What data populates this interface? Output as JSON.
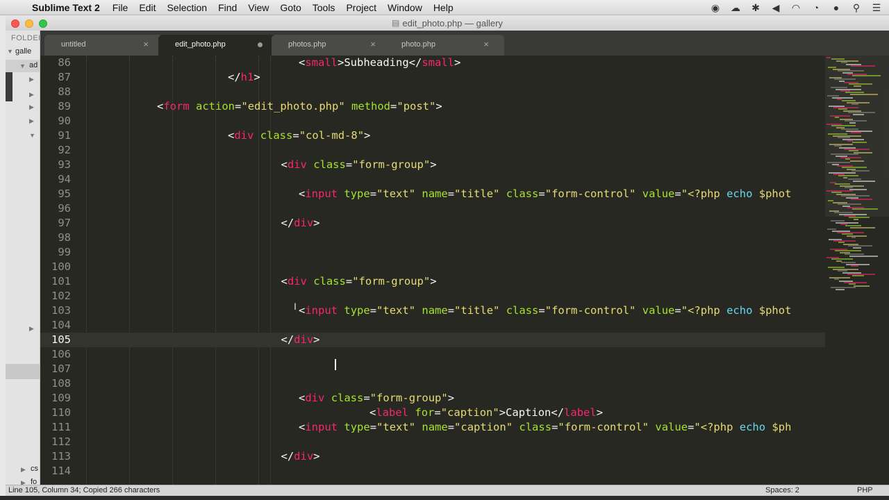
{
  "menubar": {
    "app_name": "Sublime Text 2",
    "items": [
      "File",
      "Edit",
      "Selection",
      "Find",
      "View",
      "Goto",
      "Tools",
      "Project",
      "Window",
      "Help"
    ],
    "status_icons": [
      "record-icon",
      "creative-cloud-icon",
      "bluetooth-icon",
      "volume-icon",
      "wifi-icon",
      "clock-icon",
      "user-icon",
      "spotlight-search-icon",
      "notification-list-icon"
    ]
  },
  "window": {
    "title": "edit_photo.php — gallery"
  },
  "sidebar": {
    "header": "FOLDER",
    "items": [
      "galle",
      "ad",
      "cs",
      "fo"
    ]
  },
  "tabs": [
    {
      "label": "untitled",
      "close": "×",
      "dirty": false,
      "active": false
    },
    {
      "label": "edit_photo.php",
      "close": "",
      "dirty": true,
      "active": true
    },
    {
      "label": "photos.php",
      "close": "×",
      "dirty": false,
      "active": false
    },
    {
      "label": "photo.php",
      "close": "×",
      "dirty": false,
      "active": false
    }
  ],
  "editor": {
    "current_line": 105,
    "lines": [
      {
        "num": "86",
        "indent": 12,
        "tokens": [
          [
            "t-p",
            "<"
          ],
          [
            "t-tag",
            "small"
          ],
          [
            "t-p",
            ">Subheading</"
          ],
          [
            "t-tag",
            "small"
          ],
          [
            "t-p",
            ">"
          ]
        ]
      },
      {
        "num": "87",
        "indent": 8,
        "tokens": [
          [
            "t-p",
            "</"
          ],
          [
            "t-tag",
            "h1"
          ],
          [
            "t-p",
            ">"
          ]
        ]
      },
      {
        "num": "88",
        "indent": 0,
        "tokens": []
      },
      {
        "num": "89",
        "indent": 4,
        "tokens": [
          [
            "t-p",
            "<"
          ],
          [
            "t-tag",
            "form"
          ],
          [
            "t-p",
            " "
          ],
          [
            "t-attr",
            "action"
          ],
          [
            "t-p",
            "="
          ],
          [
            "t-str",
            "\"edit_photo.php\""
          ],
          [
            "t-p",
            " "
          ],
          [
            "t-attr",
            "method"
          ],
          [
            "t-p",
            "="
          ],
          [
            "t-str",
            "\"post\""
          ],
          [
            "t-p",
            ">"
          ]
        ]
      },
      {
        "num": "90",
        "indent": 0,
        "tokens": []
      },
      {
        "num": "91",
        "indent": 8,
        "tokens": [
          [
            "t-p",
            "<"
          ],
          [
            "t-tag",
            "div"
          ],
          [
            "t-p",
            " "
          ],
          [
            "t-attr",
            "class"
          ],
          [
            "t-p",
            "="
          ],
          [
            "t-str",
            "\"col-md-8\""
          ],
          [
            "t-p",
            ">"
          ]
        ]
      },
      {
        "num": "92",
        "indent": 0,
        "tokens": []
      },
      {
        "num": "93",
        "indent": 11,
        "tokens": [
          [
            "t-p",
            "<"
          ],
          [
            "t-tag",
            "div"
          ],
          [
            "t-p",
            " "
          ],
          [
            "t-attr",
            "class"
          ],
          [
            "t-p",
            "="
          ],
          [
            "t-str",
            "\"form-group\""
          ],
          [
            "t-p",
            ">"
          ]
        ]
      },
      {
        "num": "94",
        "indent": 0,
        "tokens": []
      },
      {
        "num": "95",
        "indent": 12,
        "tokens": [
          [
            "t-p",
            "<"
          ],
          [
            "t-tag",
            "input"
          ],
          [
            "t-p",
            " "
          ],
          [
            "t-attr",
            "type"
          ],
          [
            "t-p",
            "="
          ],
          [
            "t-str",
            "\"text\""
          ],
          [
            "t-p",
            " "
          ],
          [
            "t-attr",
            "name"
          ],
          [
            "t-p",
            "="
          ],
          [
            "t-str",
            "\"title\""
          ],
          [
            "t-p",
            " "
          ],
          [
            "t-attr",
            "class"
          ],
          [
            "t-p",
            "="
          ],
          [
            "t-str",
            "\"form-control\""
          ],
          [
            "t-p",
            " "
          ],
          [
            "t-attr",
            "value"
          ],
          [
            "t-p",
            "="
          ],
          [
            "t-str",
            "\"<?php "
          ],
          [
            "t-kw",
            "echo"
          ],
          [
            "t-p",
            " "
          ],
          [
            "t-str",
            "$phot"
          ]
        ]
      },
      {
        "num": "96",
        "indent": 0,
        "tokens": []
      },
      {
        "num": "97",
        "indent": 11,
        "tokens": [
          [
            "t-p",
            "</"
          ],
          [
            "t-tag",
            "div"
          ],
          [
            "t-p",
            ">"
          ]
        ]
      },
      {
        "num": "98",
        "indent": 0,
        "tokens": []
      },
      {
        "num": "99",
        "indent": 0,
        "tokens": []
      },
      {
        "num": "100",
        "indent": 0,
        "tokens": []
      },
      {
        "num": "101",
        "indent": 11,
        "tokens": [
          [
            "t-p",
            "<"
          ],
          [
            "t-tag",
            "div"
          ],
          [
            "t-p",
            " "
          ],
          [
            "t-attr",
            "class"
          ],
          [
            "t-p",
            "="
          ],
          [
            "t-str",
            "\"form-group\""
          ],
          [
            "t-p",
            ">"
          ]
        ]
      },
      {
        "num": "102",
        "indent": 0,
        "tokens": []
      },
      {
        "num": "103",
        "indent": 12,
        "tokens": [
          [
            "t-p",
            "<"
          ],
          [
            "t-tag",
            "input"
          ],
          [
            "t-p",
            " "
          ],
          [
            "t-attr",
            "type"
          ],
          [
            "t-p",
            "="
          ],
          [
            "t-str",
            "\"text\""
          ],
          [
            "t-p",
            " "
          ],
          [
            "t-attr",
            "name"
          ],
          [
            "t-p",
            "="
          ],
          [
            "t-str",
            "\"title\""
          ],
          [
            "t-p",
            " "
          ],
          [
            "t-attr",
            "class"
          ],
          [
            "t-p",
            "="
          ],
          [
            "t-str",
            "\"form-control\""
          ],
          [
            "t-p",
            " "
          ],
          [
            "t-attr",
            "value"
          ],
          [
            "t-p",
            "="
          ],
          [
            "t-str",
            "\"<?php "
          ],
          [
            "t-kw",
            "echo"
          ],
          [
            "t-p",
            " "
          ],
          [
            "t-str",
            "$phot"
          ]
        ]
      },
      {
        "num": "104",
        "indent": 0,
        "tokens": []
      },
      {
        "num": "105",
        "indent": 11,
        "tokens": [
          [
            "t-p",
            "</"
          ],
          [
            "t-tag",
            "div"
          ],
          [
            "t-p",
            ">"
          ]
        ]
      },
      {
        "num": "106",
        "indent": 0,
        "tokens": []
      },
      {
        "num": "107",
        "indent": 0,
        "tokens": []
      },
      {
        "num": "108",
        "indent": 0,
        "tokens": []
      },
      {
        "num": "109",
        "indent": 12,
        "tokens": [
          [
            "t-p",
            "<"
          ],
          [
            "t-tag",
            "div"
          ],
          [
            "t-p",
            " "
          ],
          [
            "t-attr",
            "class"
          ],
          [
            "t-p",
            "="
          ],
          [
            "t-str",
            "\"form-group\""
          ],
          [
            "t-p",
            ">"
          ]
        ]
      },
      {
        "num": "110",
        "indent": 16,
        "tokens": [
          [
            "t-p",
            "<"
          ],
          [
            "t-tag",
            "label"
          ],
          [
            "t-p",
            " "
          ],
          [
            "t-attr",
            "for"
          ],
          [
            "t-p",
            "="
          ],
          [
            "t-str",
            "\"caption\""
          ],
          [
            "t-p",
            ">Caption</"
          ],
          [
            "t-tag",
            "label"
          ],
          [
            "t-p",
            ">"
          ]
        ]
      },
      {
        "num": "111",
        "indent": 12,
        "tokens": [
          [
            "t-p",
            "<"
          ],
          [
            "t-tag",
            "input"
          ],
          [
            "t-p",
            " "
          ],
          [
            "t-attr",
            "type"
          ],
          [
            "t-p",
            "="
          ],
          [
            "t-str",
            "\"text\""
          ],
          [
            "t-p",
            " "
          ],
          [
            "t-attr",
            "name"
          ],
          [
            "t-p",
            "="
          ],
          [
            "t-str",
            "\"caption\""
          ],
          [
            "t-p",
            " "
          ],
          [
            "t-attr",
            "class"
          ],
          [
            "t-p",
            "="
          ],
          [
            "t-str",
            "\"form-control\""
          ],
          [
            "t-p",
            " "
          ],
          [
            "t-attr",
            "value"
          ],
          [
            "t-p",
            "="
          ],
          [
            "t-str",
            "\"<?php "
          ],
          [
            "t-kw",
            "echo"
          ],
          [
            "t-p",
            " "
          ],
          [
            "t-str",
            "$ph"
          ]
        ]
      },
      {
        "num": "112",
        "indent": 0,
        "tokens": []
      },
      {
        "num": "113",
        "indent": 11,
        "tokens": [
          [
            "t-p",
            "</"
          ],
          [
            "t-tag",
            "div"
          ],
          [
            "t-p",
            ">"
          ]
        ]
      },
      {
        "num": "114",
        "indent": 0,
        "tokens": []
      }
    ]
  },
  "statusbar": {
    "left": "Line 105, Column 34; Copied 266 characters",
    "spaces": "Spaces: 2",
    "syntax": "PHP"
  },
  "colors": {
    "editor_bg": "#272822",
    "tag": "#f92672",
    "attribute": "#a6e22e",
    "string": "#e6db74",
    "keyword": "#66d9ef"
  }
}
